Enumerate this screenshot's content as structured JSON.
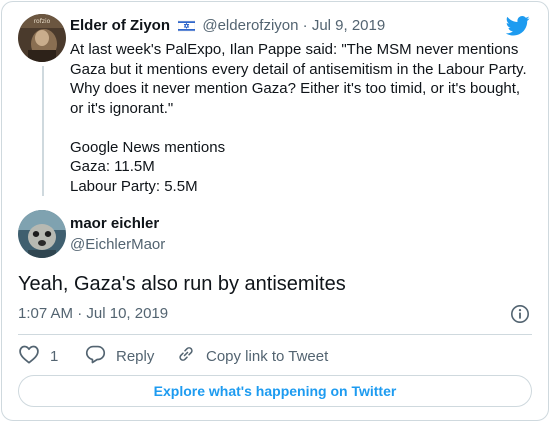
{
  "colors": {
    "accent": "#1d9bf0",
    "text": "#0f1419",
    "muted": "#536471",
    "border": "#cfd9de"
  },
  "parent_tweet": {
    "author_name": "Elder of Ziyon",
    "flag_icon": "israel-flag-icon",
    "handle": "@elderofziyon",
    "separator": "·",
    "date": "Jul 9, 2019",
    "avatar_text": "rofzio",
    "lines": [
      "At last week's PalExpo, Ilan Pappe said: \"The MSM never mentions",
      "Gaza but it mentions every detail of antisemitism in the Labour Party.",
      "Why does it never mention Gaza? Either it's too timid, or it's bought,",
      "or it's ignorant.\"",
      "",
      "Google News mentions",
      "Gaza: 11.5M",
      "Labour Party: 5.5M"
    ]
  },
  "reply_tweet": {
    "author_name": "maor eichler",
    "handle": "@EichlerMaor",
    "text": "Yeah, Gaza's also run by antisemites",
    "time": "1:07 AM",
    "separator": "·",
    "date": "Jul 10, 2019"
  },
  "actions": {
    "like_count": "1",
    "reply_label": "Reply",
    "copy_link_label": "Copy link to Tweet"
  },
  "explore_label": "Explore what's happening on Twitter",
  "icons": {
    "brand": "twitter-bird-icon",
    "info": "info-icon",
    "like": "heart-icon",
    "reply": "reply-bubble-icon",
    "link": "link-icon"
  }
}
